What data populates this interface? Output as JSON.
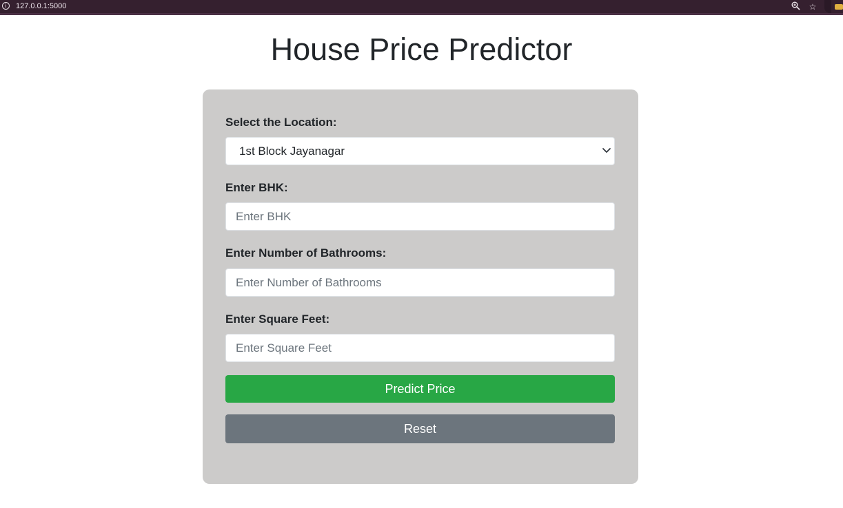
{
  "browser": {
    "url": "127.0.0.1:5000",
    "icons": [
      "info-icon",
      "zoom-icon",
      "star-icon",
      "extension-icon"
    ]
  },
  "page": {
    "title": "House Price Predictor"
  },
  "form": {
    "location": {
      "label": "Select the Location:",
      "selected": "1st Block Jayanagar"
    },
    "bhk": {
      "label": "Enter BHK:",
      "placeholder": "Enter BHK",
      "value": ""
    },
    "bathrooms": {
      "label": "Enter Number of Bathrooms:",
      "placeholder": "Enter Number of Bathrooms",
      "value": ""
    },
    "sqft": {
      "label": "Enter Square Feet:",
      "placeholder": "Enter Square Feet",
      "value": ""
    },
    "predict_label": "Predict Price",
    "reset_label": "Reset"
  },
  "colors": {
    "browser_bar": "#35202f",
    "card_bg": "#cccbca",
    "predict_button": "#28a745",
    "reset_button": "#6c757d",
    "text": "#212529"
  }
}
